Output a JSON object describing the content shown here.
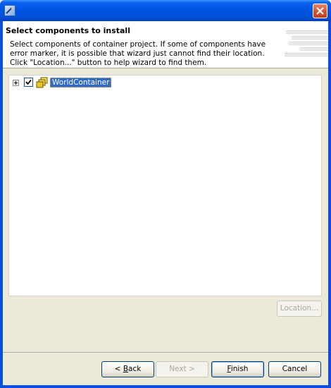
{
  "window": {
    "title": "",
    "close_icon": "close-icon"
  },
  "banner": {
    "title": "Select components to install",
    "description": "Select components of container project. If some of components have error marker, it is possible that wizard just cannot find their location. Click \"Location...\" button to help wizard to find them."
  },
  "tree": {
    "items": [
      {
        "label": "WorldContainer",
        "checked": true,
        "expanded": false,
        "icon": "components-icon"
      }
    ]
  },
  "buttons": {
    "location": "Location...",
    "back_mnemonic": "B",
    "back_rest": "ack",
    "back_prefix": "< ",
    "next": "Next >",
    "finish_mnemonic": "F",
    "finish_rest": "inish",
    "cancel": "Cancel"
  },
  "colors": {
    "titlebar": "#0054e3",
    "selection": "#316ac5",
    "dialog_bg": "#ece9d8"
  }
}
